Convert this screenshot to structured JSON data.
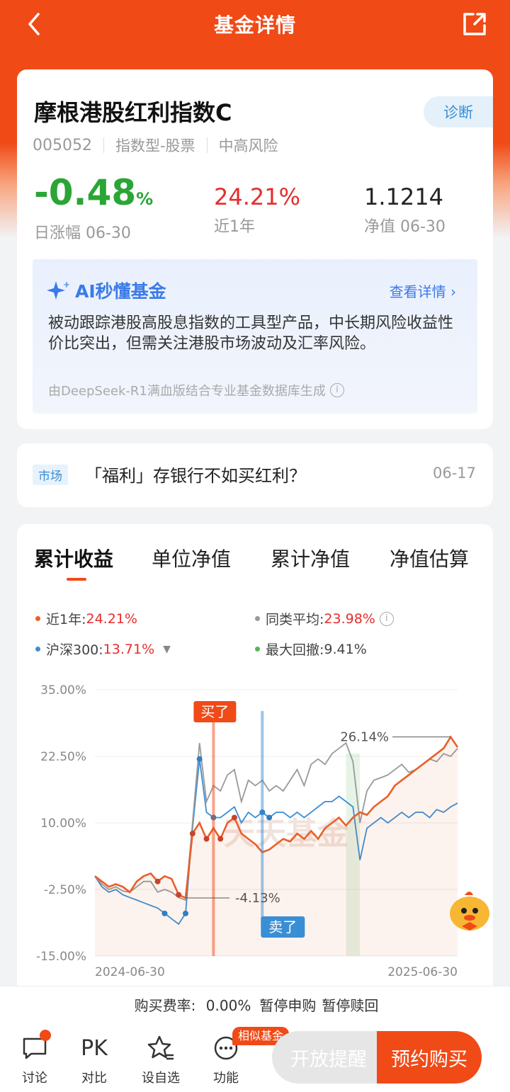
{
  "header": {
    "title": "基金详情"
  },
  "fund": {
    "name": "摩根港股红利指数C",
    "diagnose_label": "诊断",
    "code": "005052",
    "type": "指数型-股票",
    "risk": "中高风险",
    "daily_change": "-0.48",
    "daily_change_unit": "%",
    "daily_change_label": "日涨幅 06-30",
    "year_return": "24.21%",
    "year_return_label": "近1年",
    "nav": "1.1214",
    "nav_label": "净值 06-30"
  },
  "ai": {
    "title": "AI秒懂基金",
    "more": "查看详情 ›",
    "text": "被动跟踪港股高股息指数的工具型产品，中长期风险收益性价比突出，但需关注港股市场波动及汇率风险。",
    "footer": "由DeepSeek-R1满血版结合专业基金数据库生成",
    "info": "i"
  },
  "news": {
    "tag": "市场",
    "text": "「福利」存银行不如买红利？",
    "date": "06-17"
  },
  "tabs": [
    "累计收益",
    "单位净值",
    "累计净值",
    "净值估算"
  ],
  "legend": {
    "fund_label": "近1年:",
    "fund_value": "24.21%",
    "peer_label": "同类平均:",
    "peer_value": "23.98%",
    "index_label": "沪深300:",
    "index_value": "13.71%",
    "index_caret": "▼",
    "drawdown_label": "最大回撤:",
    "drawdown_value": "9.41%",
    "info": "i"
  },
  "colors": {
    "fund": "#e8602a",
    "peer": "#999999",
    "index": "#3a8ed4",
    "drawdown": "#58b55c",
    "accent": "#f04a17"
  },
  "chart_data": {
    "type": "line",
    "y_ticks": [
      "35.00%",
      "22.50%",
      "10.00%",
      "-2.50%",
      "-15.00%"
    ],
    "ylim": [
      -15,
      35
    ],
    "x_start_label": "2024-06-30",
    "x_end_label": "2025-06-30",
    "annotations": {
      "max": "26.14%",
      "min": "-4.13%",
      "buy": "买了",
      "sell": "卖了",
      "watermark": "天天基金"
    },
    "series": [
      {
        "name": "近1年",
        "values": [
          0,
          -1,
          -2,
          -1.5,
          -2,
          -3,
          -1,
          0,
          0.5,
          -1,
          0,
          -0.5,
          -3.5,
          -4.1,
          8,
          10,
          7,
          9,
          7,
          10,
          11,
          8,
          7,
          6,
          4.5,
          5,
          6,
          7,
          6.5,
          8,
          7,
          8.5,
          7,
          9,
          10,
          11,
          9.5,
          11,
          12,
          11.5,
          13,
          14,
          15,
          17,
          18,
          19,
          20,
          21,
          22,
          23,
          24,
          26.14,
          24.21
        ]
      },
      {
        "name": "同类平均",
        "values": [
          0,
          -1.5,
          -2.5,
          -2,
          -2.8,
          -3,
          -2,
          -1,
          -1,
          -3,
          -2.5,
          -3,
          -4,
          -4.5,
          10,
          25,
          14,
          17,
          16,
          19,
          20,
          14,
          18,
          17,
          18,
          16,
          17,
          16,
          18,
          20,
          17,
          21,
          22,
          21,
          23,
          24,
          25,
          21.5,
          10,
          16,
          18,
          18.5,
          19,
          20,
          21,
          19.5,
          20,
          21,
          22,
          21.5,
          23,
          22.5,
          23.98
        ]
      },
      {
        "name": "沪深300",
        "values": [
          0,
          -2,
          -3,
          -2.5,
          -3.5,
          -4,
          -4.5,
          -5,
          -5.5,
          -6,
          -7,
          -8,
          -9,
          -7,
          9,
          22,
          12,
          11,
          11,
          12,
          13,
          10,
          12,
          11,
          12,
          11,
          12,
          12,
          11,
          12,
          11,
          12,
          13,
          14,
          14,
          15,
          14,
          13,
          3,
          9,
          10,
          11,
          10,
          11,
          12,
          11,
          12,
          12,
          11,
          12.5,
          12,
          13,
          13.71
        ]
      }
    ]
  },
  "fee": {
    "label": "购买费率:",
    "rate": "0.00%",
    "purchase": "暂停申购",
    "redeem": "暂停赎回"
  },
  "bottom": {
    "discuss": "讨论",
    "compare": "对比",
    "compare_icon": "PK",
    "watch": "设自选",
    "functions": "功能",
    "similar_tag": "相似基金",
    "remind": "开放提醒",
    "buy": "预约购买"
  }
}
